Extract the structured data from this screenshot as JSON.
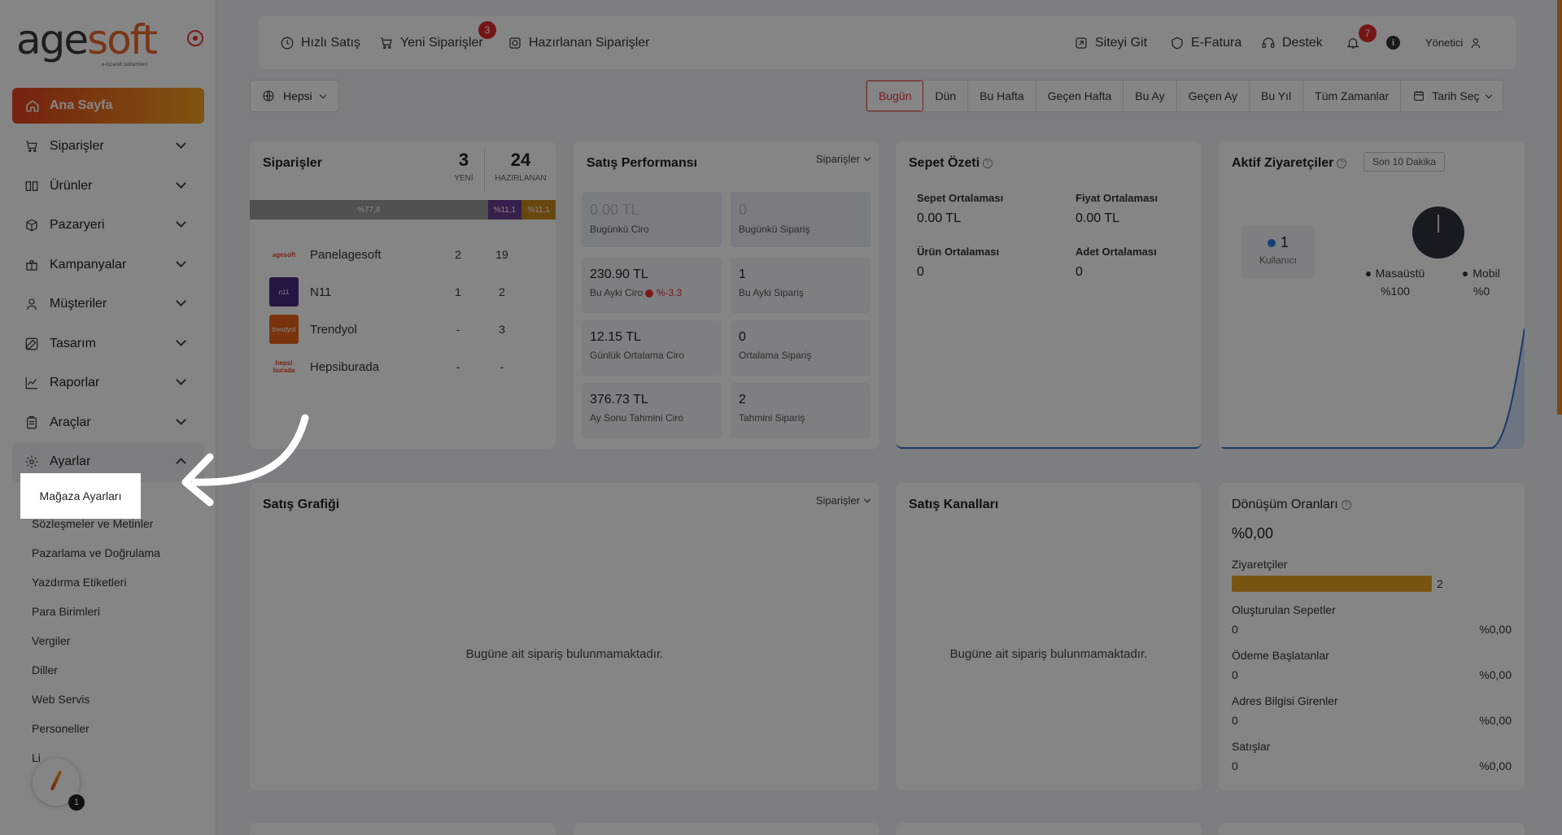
{
  "sidebar": {
    "logo_main": "age",
    "logo_soft": "soft",
    "logo_tag": "e-ticaret sistemleri",
    "home_label": "Ana Sayfa",
    "items": [
      {
        "label": "Siparişler",
        "icon": "cart-icon"
      },
      {
        "label": "Ürünler",
        "icon": "book-icon"
      },
      {
        "label": "Pazaryeri",
        "icon": "box-icon"
      },
      {
        "label": "Kampanyalar",
        "icon": "gift-icon"
      },
      {
        "label": "Müşteriler",
        "icon": "user-icon"
      },
      {
        "label": "Tasarım",
        "icon": "edit-icon"
      },
      {
        "label": "Raporlar",
        "icon": "chart-icon"
      },
      {
        "label": "Araçlar",
        "icon": "clipboard-icon"
      },
      {
        "label": "Ayarlar",
        "icon": "gear-icon"
      }
    ],
    "highlighted_sub": "Mağaza Ayarları",
    "sub_items": [
      "Sözleşmeler ve Metinler",
      "Pazarlama ve Doğrulama",
      "Yazdırma Etiketleri",
      "Para Birimleri",
      "Vergiler",
      "Diller",
      "Web Servis",
      "Personeller",
      "Li"
    ],
    "float_count": "1"
  },
  "topbar": {
    "quick_sale": "Hızlı Satış",
    "new_orders": "Yeni Siparişler",
    "new_orders_badge": "3",
    "prepared_orders": "Hazırlanan Siparişler",
    "go_site": "Siteyi Git",
    "einvoice": "E-Fatura",
    "support": "Destek",
    "bell_badge": "7",
    "user": "Yönetici"
  },
  "filters": {
    "scope": "Hepsi",
    "periods": [
      "Bugün",
      "Dün",
      "Bu Hafta",
      "Geçen Hafta",
      "Bu Ay",
      "Geçen Ay",
      "Bu Yıl",
      "Tüm Zamanlar"
    ],
    "active_period": "Bugün",
    "date_pick": "Tarih Seç"
  },
  "orders": {
    "title": "Siparişler",
    "new_count": "3",
    "new_label": "YENİ",
    "prepared_count": "24",
    "prepared_label": "HAZIRLANAN",
    "bar": [
      {
        "label": "%77,8",
        "fraction": 0.778,
        "color": "#9b9b9b"
      },
      {
        "label": "%11,1",
        "fraction": 0.111,
        "color": "#6a3e93"
      },
      {
        "label": "%11,1",
        "fraction": 0.111,
        "color": "#c8891c"
      }
    ],
    "rows": [
      {
        "name": "Panelagesoft",
        "new": "2",
        "prepared": "19",
        "logo_text": "agesoft",
        "logo_color": "#ffffff"
      },
      {
        "name": "N11",
        "new": "1",
        "prepared": "2",
        "logo_text": "n11",
        "logo_color": "#4a2a80"
      },
      {
        "name": "Trendyol",
        "new": "-",
        "prepared": "3",
        "logo_text": "trendyol",
        "logo_color": "#e8641b"
      },
      {
        "name": "Hepsiburada",
        "new": "-",
        "prepared": "-",
        "logo_text": "hepsi burada",
        "logo_color": "#ffffff"
      }
    ]
  },
  "performance": {
    "title": "Satış Performansı",
    "dropdown": "Siparişler",
    "boxes": [
      {
        "value": "0.00 TL",
        "label": "Bugünkü Ciro"
      },
      {
        "value": "0",
        "label": "Bugünkü Sipariş"
      },
      {
        "value": "230.90 TL",
        "label": "Bu Ayki Ciro",
        "delta": "%-3.3"
      },
      {
        "value": "1",
        "label": "Bu Ayki Sipariş"
      },
      {
        "value": "12.15 TL",
        "label": "Günlük Ortalama Ciro"
      },
      {
        "value": "0",
        "label": "Ortalama Sipariş"
      },
      {
        "value": "376.73 TL",
        "label": "Ay Sonu Tahmini Ciro"
      },
      {
        "value": "2",
        "label": "Tahmini Sipariş"
      }
    ]
  },
  "cart": {
    "title": "Sepet Özeti",
    "items": [
      {
        "label": "Sepet Ortalaması",
        "value": "0.00 TL"
      },
      {
        "label": "Fiyat Ortalaması",
        "value": "0.00 TL"
      },
      {
        "label": "Ürün Ortalaması",
        "value": "0"
      },
      {
        "label": "Adet Ortalaması",
        "value": "0"
      }
    ]
  },
  "visitors": {
    "title": "Aktif Ziyaretçiler",
    "window": "Son 10 Dakika",
    "count": "1",
    "count_label": "Kullanıcı",
    "desktop_label": "Masaüstü",
    "desktop_value": "%100",
    "mobile_label": "Mobil",
    "mobile_value": "%0"
  },
  "sales_chart": {
    "title": "Satış Grafiği",
    "dropdown": "Siparişler",
    "empty": "Bugüne ait sipariş bulunmamaktadır."
  },
  "channels": {
    "title": "Satış Kanalları",
    "empty": "Bugüne ait sipariş bulunmamaktadır."
  },
  "conversion": {
    "title": "Dönüşüm Oranları",
    "rate": "%0,00",
    "visitors_label": "Ziyaretçiler",
    "visitors_value": "2",
    "visitors_fill": 1.0,
    "rows": [
      {
        "label": "Oluşturulan Sepetler",
        "count": "0",
        "pct": "%0,00"
      },
      {
        "label": "Ödeme Başlatanlar",
        "count": "0",
        "pct": "%0,00"
      },
      {
        "label": "Adres Bilgisi Girenler",
        "count": "0",
        "pct": "%0,00"
      },
      {
        "label": "Satışlar",
        "count": "0",
        "pct": "%0,00"
      }
    ]
  }
}
